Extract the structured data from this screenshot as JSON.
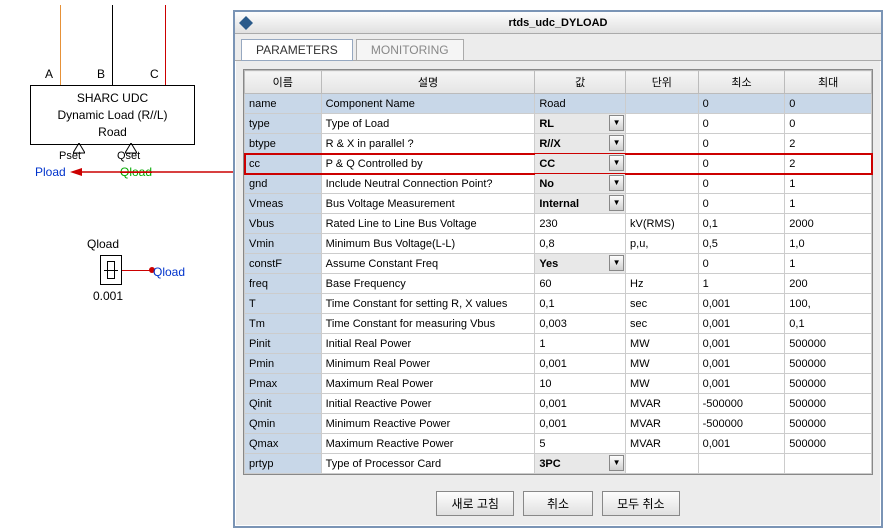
{
  "diagram": {
    "block_line1": "SHARC UDC",
    "block_line2": "Dynamic Load (R//L)",
    "block_line3": "Road",
    "term_a": "A",
    "term_b": "B",
    "term_c": "C",
    "pset": "Pset",
    "qset": "Qset",
    "pload": "Pload",
    "qload_strike": "Qload",
    "qload_box_label": "Qload",
    "qload_value": "0.001",
    "qload_wire_label": "Qload"
  },
  "dialog": {
    "title": "rtds_udc_DYLOAD",
    "tabs": {
      "parameters": "PARAMETERS",
      "monitoring": "MONITORING"
    },
    "columns": {
      "name": "이름",
      "desc": "설명",
      "val": "값",
      "unit": "단위",
      "min": "최소",
      "max": "최대"
    },
    "rows": [
      {
        "name": "name",
        "desc": "Component Name",
        "val": "Road",
        "dd": false,
        "unit": "",
        "min": "0",
        "max": "0",
        "hdr": true
      },
      {
        "name": "type",
        "desc": "Type of Load",
        "val": "RL",
        "dd": true,
        "unit": "",
        "min": "0",
        "max": "0"
      },
      {
        "name": "btype",
        "desc": "R & X in parallel ?",
        "val": "R//X",
        "dd": true,
        "unit": "",
        "min": "0",
        "max": "2"
      },
      {
        "name": "cc",
        "desc": "P & Q Controlled by",
        "val": "CC",
        "dd": true,
        "unit": "",
        "min": "0",
        "max": "2",
        "cc": true
      },
      {
        "name": "gnd",
        "desc": "Include Neutral Connection Point?",
        "val": "No",
        "dd": true,
        "unit": "",
        "min": "0",
        "max": "1"
      },
      {
        "name": "Vmeas",
        "desc": "Bus Voltage Measurement",
        "val": "Internal",
        "dd": true,
        "unit": "",
        "min": "0",
        "max": "1"
      },
      {
        "name": "Vbus",
        "desc": "Rated Line to Line Bus Voltage",
        "val": "230",
        "dd": false,
        "unit": "kV(RMS)",
        "min": "0,1",
        "max": "2000"
      },
      {
        "name": "Vmin",
        "desc": "Minimum Bus Voltage(L-L)",
        "val": "0,8",
        "dd": false,
        "unit": "p,u,",
        "min": "0,5",
        "max": "1,0"
      },
      {
        "name": "constF",
        "desc": "Assume Constant Freq",
        "val": "Yes",
        "dd": true,
        "unit": "",
        "min": "0",
        "max": "1"
      },
      {
        "name": "freq",
        "desc": "Base Frequency",
        "val": "60",
        "dd": false,
        "unit": "Hz",
        "min": "1",
        "max": "200"
      },
      {
        "name": "T",
        "desc": "Time Constant for setting R, X values",
        "val": "0,1",
        "dd": false,
        "unit": "sec",
        "min": "0,001",
        "max": "100,"
      },
      {
        "name": "Tm",
        "desc": "Time Constant for measuring Vbus",
        "val": "0,003",
        "dd": false,
        "unit": "sec",
        "min": "0,001",
        "max": "0,1"
      },
      {
        "name": "Pinit",
        "desc": "Initial Real Power",
        "val": "1",
        "dd": false,
        "unit": "MW",
        "min": "0,001",
        "max": "500000"
      },
      {
        "name": "Pmin",
        "desc": "Minimum Real Power",
        "val": "0,001",
        "dd": false,
        "unit": "MW",
        "min": "0,001",
        "max": "500000"
      },
      {
        "name": "Pmax",
        "desc": "Maximum Real Power",
        "val": "10",
        "dd": false,
        "unit": "MW",
        "min": "0,001",
        "max": "500000"
      },
      {
        "name": "Qinit",
        "desc": "Initial Reactive Power",
        "val": "0,001",
        "dd": false,
        "unit": "MVAR",
        "min": "-500000",
        "max": "500000"
      },
      {
        "name": "Qmin",
        "desc": "Minimum Reactive Power",
        "val": "0,001",
        "dd": false,
        "unit": "MVAR",
        "min": "-500000",
        "max": "500000"
      },
      {
        "name": "Qmax",
        "desc": "Maximum Reactive Power",
        "val": "5",
        "dd": false,
        "unit": "MVAR",
        "min": "0,001",
        "max": "500000"
      },
      {
        "name": "prtyp",
        "desc": "Type of Processor Card",
        "val": "3PC",
        "dd": true,
        "unit": "",
        "min": "",
        "max": ""
      }
    ],
    "buttons": {
      "refresh": "새로 고침",
      "cancel": "취소",
      "cancel_all": "모두 취소"
    }
  }
}
